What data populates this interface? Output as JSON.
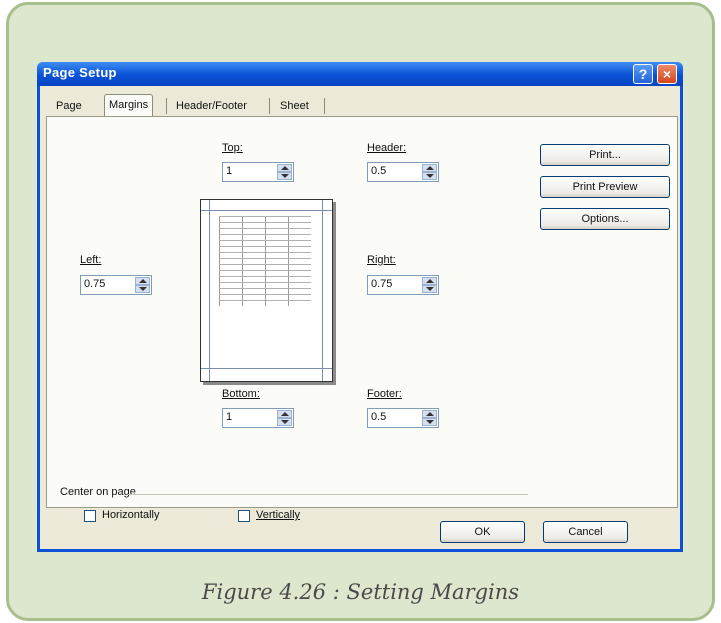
{
  "dialog": {
    "title": "Page Setup",
    "help_glyph": "?",
    "close_glyph": "×",
    "tabs": [
      {
        "label": "Page",
        "active": false
      },
      {
        "label": "Margins",
        "active": true
      },
      {
        "label": "Header/Footer",
        "active": false
      },
      {
        "label": "Sheet",
        "active": false
      }
    ],
    "margins": {
      "top": {
        "label": "Top:",
        "value": "1"
      },
      "header": {
        "label": "Header:",
        "value": "0.5"
      },
      "left": {
        "label": "Left:",
        "value": "0.75"
      },
      "right": {
        "label": "Right:",
        "value": "0.75"
      },
      "bottom": {
        "label": "Bottom:",
        "value": "1"
      },
      "footer": {
        "label": "Footer:",
        "value": "0.5"
      }
    },
    "side_buttons": {
      "print": "Print...",
      "print_preview": "Print Preview",
      "options": "Options..."
    },
    "center_on_page": {
      "label": "Center on page",
      "horizontally": {
        "label": "Horizontally",
        "checked": false
      },
      "vertically": {
        "label": "Vertically",
        "checked": false
      }
    },
    "ok_label": "OK",
    "cancel_label": "Cancel"
  },
  "caption": "Figure 4.26 : Setting Margins",
  "colors": {
    "frame_bg": "#dde7ce",
    "frame_border": "#a6bf8c",
    "titlebar": "#0a52d6",
    "dialog_bg": "#ece9d8"
  }
}
